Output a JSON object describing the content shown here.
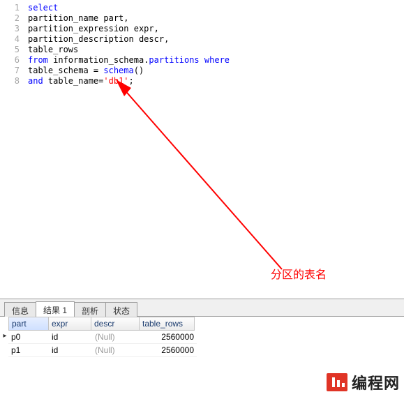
{
  "editor": {
    "lines": [
      {
        "n": 1,
        "segs": [
          {
            "cls": "kw",
            "t": "select"
          }
        ]
      },
      {
        "n": 2,
        "segs": [
          {
            "cls": "",
            "t": "partition_name part,"
          }
        ]
      },
      {
        "n": 3,
        "segs": [
          {
            "cls": "",
            "t": "partition_expression expr,"
          }
        ]
      },
      {
        "n": 4,
        "segs": [
          {
            "cls": "",
            "t": "partition_description descr,"
          }
        ]
      },
      {
        "n": 5,
        "segs": [
          {
            "cls": "",
            "t": "table_rows"
          }
        ]
      },
      {
        "n": 6,
        "segs": [
          {
            "cls": "kw",
            "t": "from"
          },
          {
            "cls": "",
            "t": " information_schema."
          },
          {
            "cls": "id2",
            "t": "partitions"
          },
          {
            "cls": "",
            "t": " "
          },
          {
            "cls": "kw",
            "t": "where"
          }
        ]
      },
      {
        "n": 7,
        "segs": [
          {
            "cls": "",
            "t": "table_schema = "
          },
          {
            "cls": "id2",
            "t": "schema"
          },
          {
            "cls": "",
            "t": "()"
          }
        ]
      },
      {
        "n": 8,
        "segs": [
          {
            "cls": "kw",
            "t": "and"
          },
          {
            "cls": "",
            "t": " table_name="
          },
          {
            "cls": "str",
            "t": "'db1'"
          },
          {
            "cls": "",
            "t": ";"
          }
        ]
      }
    ]
  },
  "annotation": {
    "label": "分区的表名"
  },
  "tabs": {
    "items": [
      "信息",
      "结果 1",
      "剖析",
      "状态"
    ],
    "active_index": 1
  },
  "results": {
    "columns": [
      "part",
      "expr",
      "descr",
      "table_rows"
    ],
    "sorted_col_index": 0,
    "rows": [
      {
        "part": "p0",
        "expr": "id",
        "descr": "(Null)",
        "table_rows": "2560000",
        "current": true
      },
      {
        "part": "p1",
        "expr": "id",
        "descr": "(Null)",
        "table_rows": "2560000",
        "current": false
      }
    ]
  },
  "brand": {
    "text": "编程网"
  }
}
